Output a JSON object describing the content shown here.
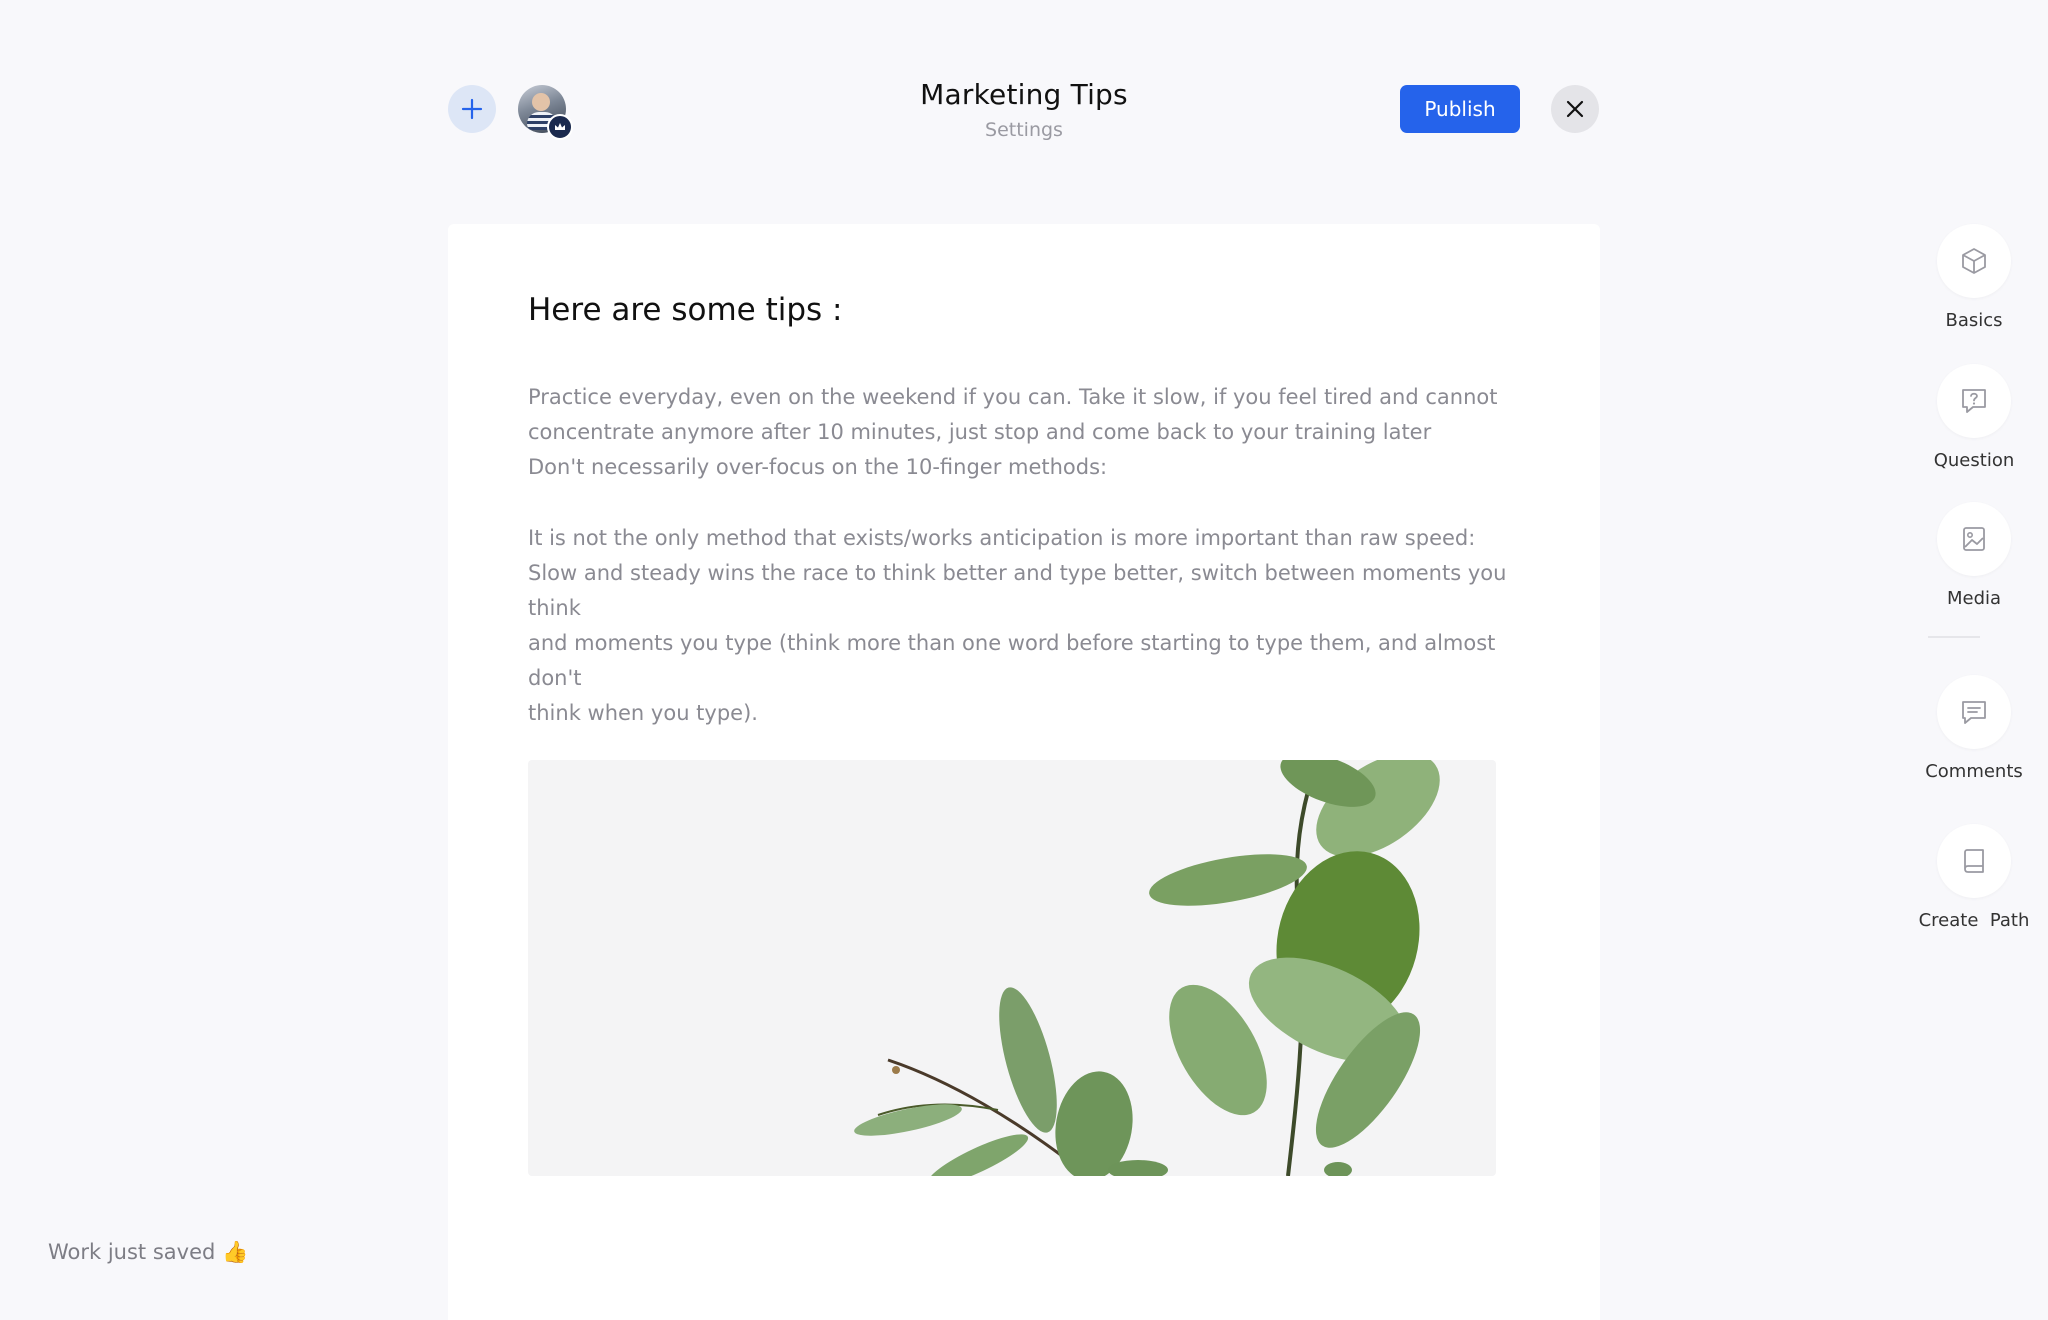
{
  "header": {
    "title": "Marketing Tips",
    "subtitle": "Settings",
    "publish_label": "Publish"
  },
  "content": {
    "heading": "Here are some tips :",
    "paragraph1_lines": [
      "Practice everyday, even on the weekend if you can. Take it slow, if you feel tired and cannot",
      "concentrate anymore after 10 minutes, just stop and come back to your training later",
      "Don't necessarily over-focus on the 10-finger methods:"
    ],
    "paragraph2_lines": [
      "It is not the only method that exists/works  anticipation is more important than raw speed:",
      "Slow and steady wins the race to think better and type better, switch between moments you think",
      "and moments you type (think more than one word before starting to type them, and almost don't",
      "think when you type)."
    ]
  },
  "status": {
    "saved_text": "Work just saved 👍"
  },
  "rail": {
    "items": [
      {
        "label": "Basics",
        "icon": "cube-icon"
      },
      {
        "label": "Question",
        "icon": "question-bubble-icon"
      },
      {
        "label": "Media",
        "icon": "image-icon"
      },
      {
        "label": "Comments",
        "icon": "comment-icon"
      },
      {
        "label": "Create  Path",
        "icon": "book-icon"
      }
    ]
  },
  "colors": {
    "accent": "#2563eb",
    "background": "#f8f8fb"
  }
}
